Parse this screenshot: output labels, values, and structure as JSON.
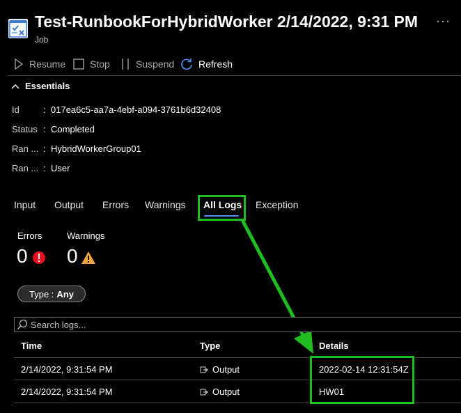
{
  "header": {
    "title": "Test-RunbookForHybridWorker 2/14/2022, 9:31 PM",
    "subtitle": "Job",
    "more_label": "···"
  },
  "toolbar": {
    "resume": "Resume",
    "stop": "Stop",
    "suspend": "Suspend",
    "refresh": "Refresh"
  },
  "essentials": {
    "heading": "Essentials",
    "props": [
      {
        "label": "Id",
        "value": "017ea6c5-aa7a-4ebf-a094-3761b6d32408"
      },
      {
        "label": "Status",
        "value": "Completed"
      },
      {
        "label": "Ran ...",
        "value": "HybridWorkerGroup01"
      },
      {
        "label": "Ran ...",
        "value": "User"
      }
    ]
  },
  "tabs": [
    "Input",
    "Output",
    "Errors",
    "Warnings",
    "All Logs",
    "Exception"
  ],
  "active_tab": "All Logs",
  "counts": {
    "errors_label": "Errors",
    "errors_value": "0",
    "warnings_label": "Warnings",
    "warnings_value": "0"
  },
  "filter": {
    "prefix": "Type :",
    "value": "Any"
  },
  "search": {
    "placeholder": "Search logs..."
  },
  "table": {
    "columns": [
      "Time",
      "Type",
      "Details"
    ],
    "rows": [
      {
        "time": "2/14/2022, 9:31:54 PM",
        "type": "Output",
        "details": "2022-02-14 12:31:54Z"
      },
      {
        "time": "2/14/2022, 9:31:54 PM",
        "type": "Output",
        "details": "HW01"
      }
    ]
  },
  "colors": {
    "highlight": "#1fbd1f",
    "accent": "#4f8ef7",
    "error": "#e81123",
    "warning": "#f2a33a"
  }
}
